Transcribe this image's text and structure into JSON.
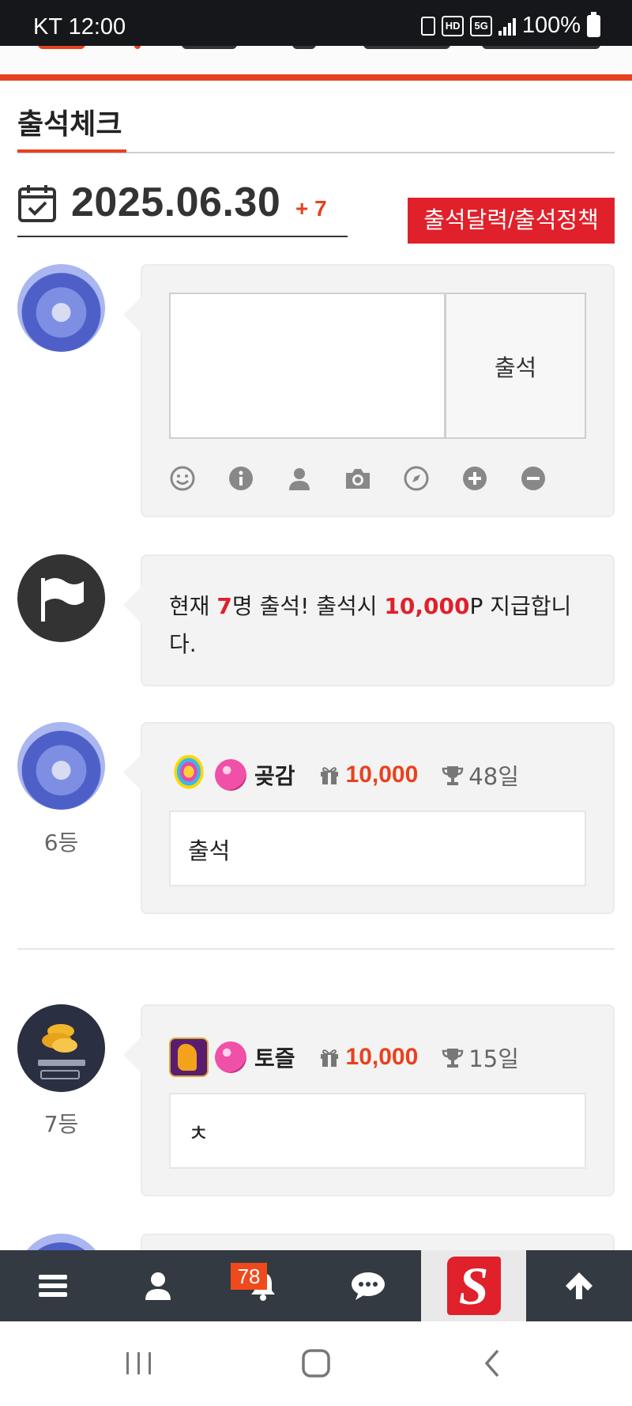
{
  "status_bar": {
    "carrier_time": "KT 12:00",
    "network": "5G",
    "hd": "HD",
    "battery": "100%"
  },
  "header": {
    "title": "출석체크"
  },
  "date_bar": {
    "date": "2025.06.30",
    "increment": "+ 7",
    "policy_button": "출석달력/출석정책"
  },
  "composer": {
    "input_value": "",
    "submit_label": "출석",
    "toolbar": [
      "smile-icon",
      "info-icon",
      "user-icon",
      "camera-icon",
      "compass-icon",
      "plus-circle-icon",
      "minus-circle-icon"
    ]
  },
  "notice": {
    "prefix": "현재 ",
    "count": "7",
    "mid": "명 출석! 출석시 ",
    "points": "10,000",
    "suffix": "P 지급합니다."
  },
  "entries": [
    {
      "rank": "6등",
      "nickname": "곶감",
      "points": "10,000",
      "days": "48일",
      "message": "출석"
    },
    {
      "rank": "7등",
      "nickname": "토즐",
      "points": "10,000",
      "days": "15일",
      "message": "ㅊ"
    }
  ],
  "bottom_nav": {
    "notification_badge": "78",
    "logo": "S"
  },
  "colors": {
    "accent": "#e8411f",
    "button_red": "#e0202a",
    "nav_bg": "#333a42",
    "bubble_bg": "#f3f3f3"
  }
}
